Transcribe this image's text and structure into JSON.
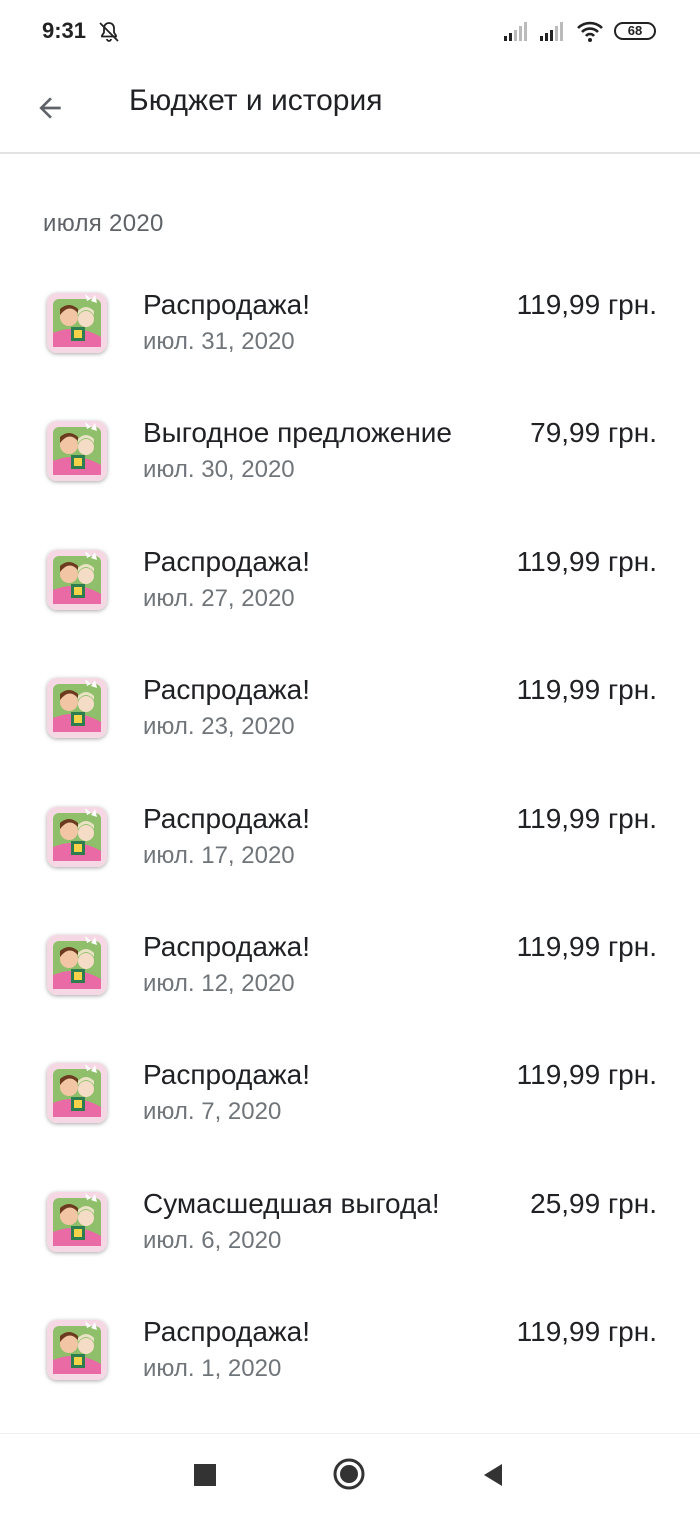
{
  "status_bar": {
    "time": "9:31",
    "battery": "68",
    "icons": [
      "bell-off-icon",
      "signal-icon",
      "signal-icon",
      "wifi-icon",
      "battery-icon"
    ]
  },
  "app_bar": {
    "title": "Бюджет и история",
    "back_icon": "arrow-back-icon"
  },
  "section": {
    "header": "июля 2020"
  },
  "purchases": [
    {
      "title": "Распродажа!",
      "date": "июл. 31, 2020",
      "price": "119,99 грн."
    },
    {
      "title": "Выгодное предложение",
      "date": "июл. 30, 2020",
      "price": "79,99 грн."
    },
    {
      "title": "Распродажа!",
      "date": "июл. 27, 2020",
      "price": "119,99 грн."
    },
    {
      "title": "Распродажа!",
      "date": "июл. 23, 2020",
      "price": "119,99 грн."
    },
    {
      "title": "Распродажа!",
      "date": "июл. 17, 2020",
      "price": "119,99 грн."
    },
    {
      "title": "Распродажа!",
      "date": "июл. 12, 2020",
      "price": "119,99 грн."
    },
    {
      "title": "Распродажа!",
      "date": "июл. 7, 2020",
      "price": "119,99 грн."
    },
    {
      "title": "Сумасшедшая выгода!",
      "date": "июл. 6, 2020",
      "price": "25,99 грн."
    },
    {
      "title": "Распродажа!",
      "date": "июл. 1, 2020",
      "price": "119,99 грн."
    }
  ],
  "nav_bar": {
    "icons": [
      "recents-square-icon",
      "home-circle-icon",
      "back-triangle-icon"
    ]
  },
  "colors": {
    "primary_text": "#202124",
    "secondary_text": "#70757a",
    "divider": "#e2e2e2"
  }
}
